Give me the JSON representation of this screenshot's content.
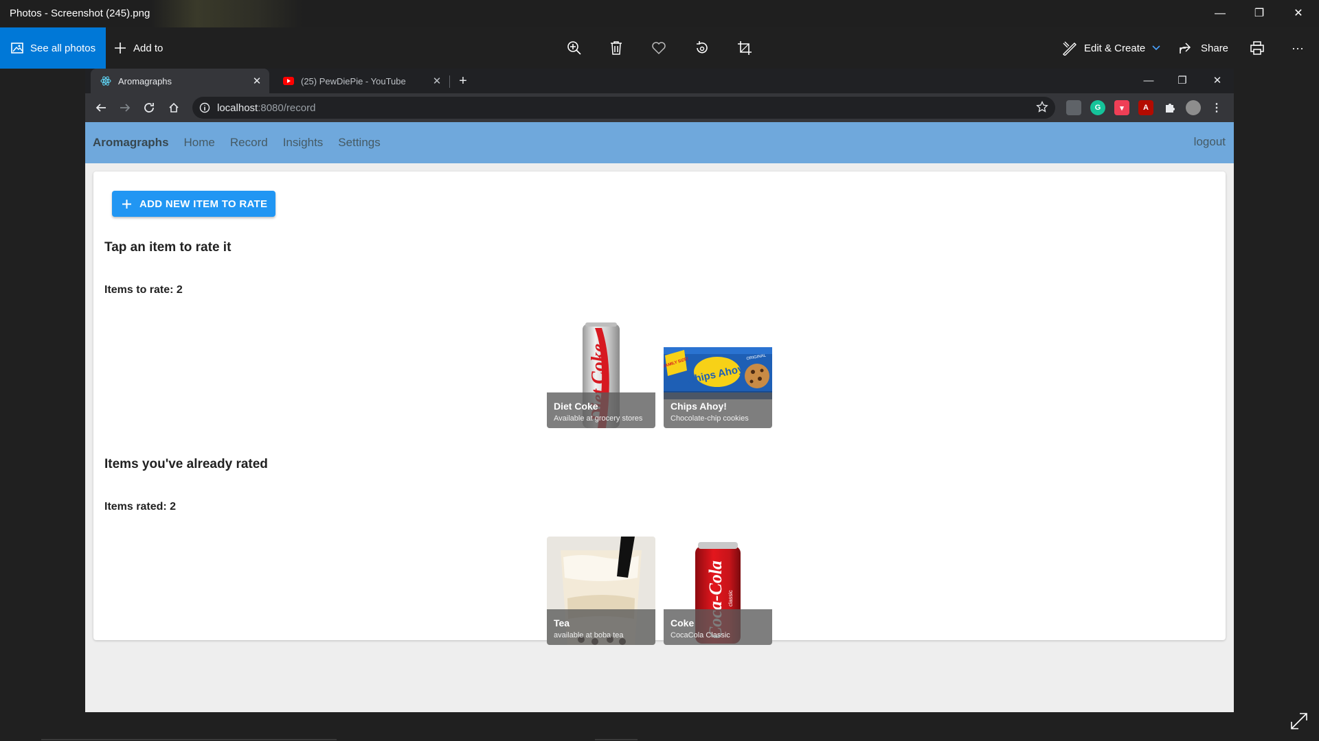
{
  "photos": {
    "title": "Photos - Screenshot (245).png",
    "see_all": "See all photos",
    "add_to": "Add to",
    "edit_create": "Edit & Create",
    "share": "Share",
    "minimize": "—",
    "maximize": "❐",
    "close": "✕",
    "more": "···"
  },
  "browser": {
    "tabs": [
      {
        "label": "Aromagraphs",
        "close": "✕"
      },
      {
        "label": "(25) PewDiePie - YouTube",
        "close": "✕"
      }
    ],
    "new_tab": "+",
    "url_host": "localhost",
    "url_path": ":8080/record",
    "minimize": "—",
    "maximize": "❐",
    "close": "✕"
  },
  "app": {
    "brand": "Aromagraphs",
    "nav": [
      "Home",
      "Record",
      "Insights",
      "Settings"
    ],
    "logout": "logout",
    "add_button": "ADD NEW ITEM TO RATE",
    "to_rate_heading": "Tap an item to rate it",
    "to_rate_count": "Items to rate: 2",
    "rated_heading": "Items you've already rated",
    "rated_count": "Items rated: 2",
    "to_rate_items": [
      {
        "name": "Diet Coke",
        "desc": "Available at grocery stores"
      },
      {
        "name": "Chips Ahoy!",
        "desc": "Chocolate-chip cookies"
      }
    ],
    "rated_items": [
      {
        "name": "Tea",
        "desc": "available at boba tea"
      },
      {
        "name": "Coke",
        "desc": "CocaCola Classic"
      }
    ],
    "product_labels": {
      "diet_coke_can": "Diet Coke",
      "chips_ahoy_logo": "Chips Ahoy!",
      "chips_ahoy_badge": "FAMILY SIZE!",
      "chips_ahoy_original": "ORIGINAL",
      "coke_can": "Coca-Cola",
      "coke_classic": "classic"
    }
  },
  "colors": {
    "photos_accent": "#0078d7",
    "appbar": "#6fa8dc",
    "primary_button": "#2196f3"
  }
}
